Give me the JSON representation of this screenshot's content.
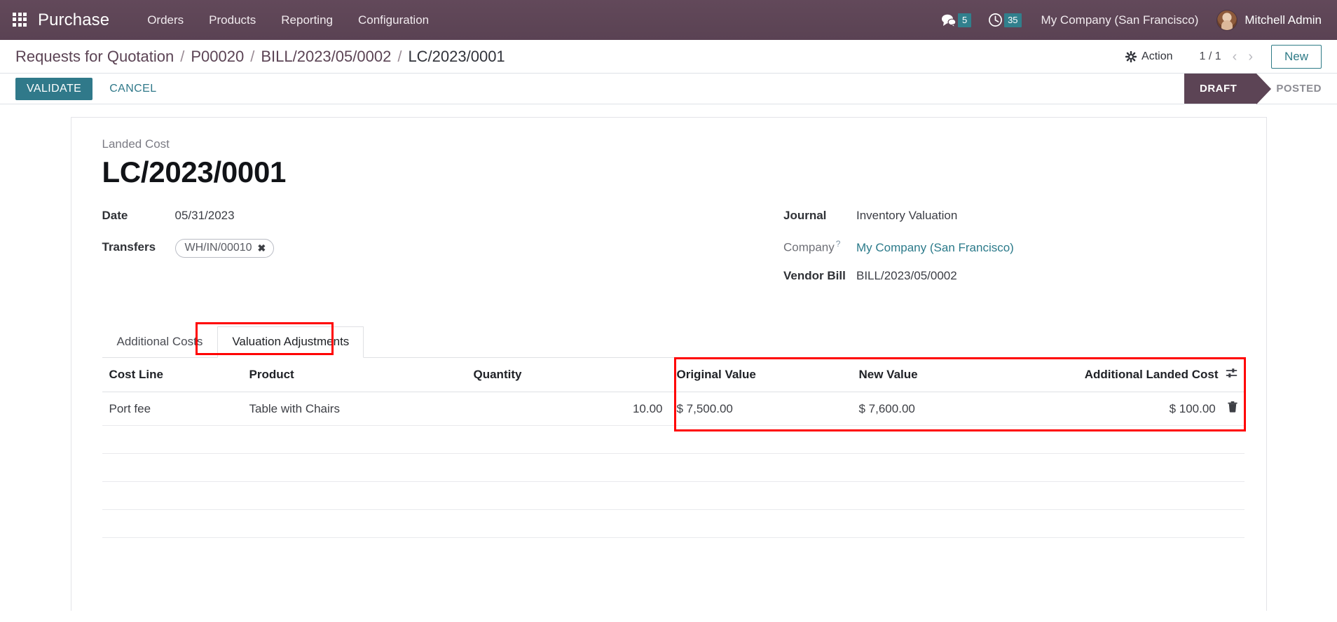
{
  "navbar": {
    "apps_icon": "apps-grid-icon",
    "brand": "Purchase",
    "menu": [
      {
        "label": "Orders"
      },
      {
        "label": "Products"
      },
      {
        "label": "Reporting"
      },
      {
        "label": "Configuration"
      }
    ],
    "messages_icon": "chat-bubble-icon",
    "messages_count": "5",
    "activities_icon": "clock-icon",
    "activities_count": "35",
    "company": "My Company (San Francisco)",
    "user": "Mitchell Admin",
    "accent_bg": "#5c4455",
    "badge_color": "#31808d"
  },
  "control_panel": {
    "breadcrumb": [
      {
        "label": "Requests for Quotation",
        "current": false
      },
      {
        "label": "P00020",
        "current": false
      },
      {
        "label": "BILL/2023/05/0002",
        "current": false
      },
      {
        "label": "LC/2023/0001",
        "current": true
      }
    ],
    "separator": "/",
    "action_label": "Action",
    "pager": "1 / 1",
    "prev_icon": "chevron-left-icon",
    "next_icon": "chevron-right-icon",
    "new_label": "New"
  },
  "statusbar": {
    "validate_label": "VALIDATE",
    "cancel_label": "CANCEL",
    "stages": [
      {
        "label": "DRAFT",
        "active": true
      },
      {
        "label": "POSTED",
        "active": false
      }
    ],
    "active_color": "#5c4455"
  },
  "form": {
    "subtitle": "Landed Cost",
    "title": "LC/2023/0001",
    "left_fields": [
      {
        "label": "Date",
        "value": "05/31/2023",
        "type": "text"
      },
      {
        "label": "Transfers",
        "value": "WH/IN/00010",
        "type": "tag",
        "remove_icon": "close-icon"
      }
    ],
    "right_fields": [
      {
        "label": "Journal",
        "value": "Inventory Valuation",
        "type": "text",
        "muted_label": false
      },
      {
        "label": "Company",
        "value": "My Company (San Francisco)",
        "type": "link",
        "muted_label": true,
        "help": "?"
      },
      {
        "label": "Vendor Bill",
        "value": "BILL/2023/05/0002",
        "type": "text",
        "muted_label": false
      }
    ]
  },
  "notebook": {
    "tabs": [
      {
        "label": "Additional Costs",
        "active": false
      },
      {
        "label": "Valuation Adjustments",
        "active": true
      }
    ]
  },
  "table": {
    "columns": [
      {
        "label": "Cost Line",
        "align": "left"
      },
      {
        "label": "Product",
        "align": "left"
      },
      {
        "label": "Quantity",
        "align": "right"
      },
      {
        "label": "Original Value",
        "align": "left"
      },
      {
        "label": "New Value",
        "align": "left"
      },
      {
        "label": "Additional Landed Cost",
        "align": "right"
      }
    ],
    "optional_columns_icon": "sliders-icon",
    "rows": [
      {
        "cost_line": "Port fee",
        "product": "Table with Chairs",
        "quantity": "10.00",
        "original_value": "$ 7,500.00",
        "new_value": "$ 7,600.00",
        "additional_landed_cost": "$ 100.00",
        "delete_icon": "trash-icon"
      }
    ],
    "empty_rows": 4
  },
  "annotations": {
    "highlight_color": "#ff0000",
    "regions": [
      "valuation-adjustments-tab",
      "value-columns-block"
    ]
  }
}
